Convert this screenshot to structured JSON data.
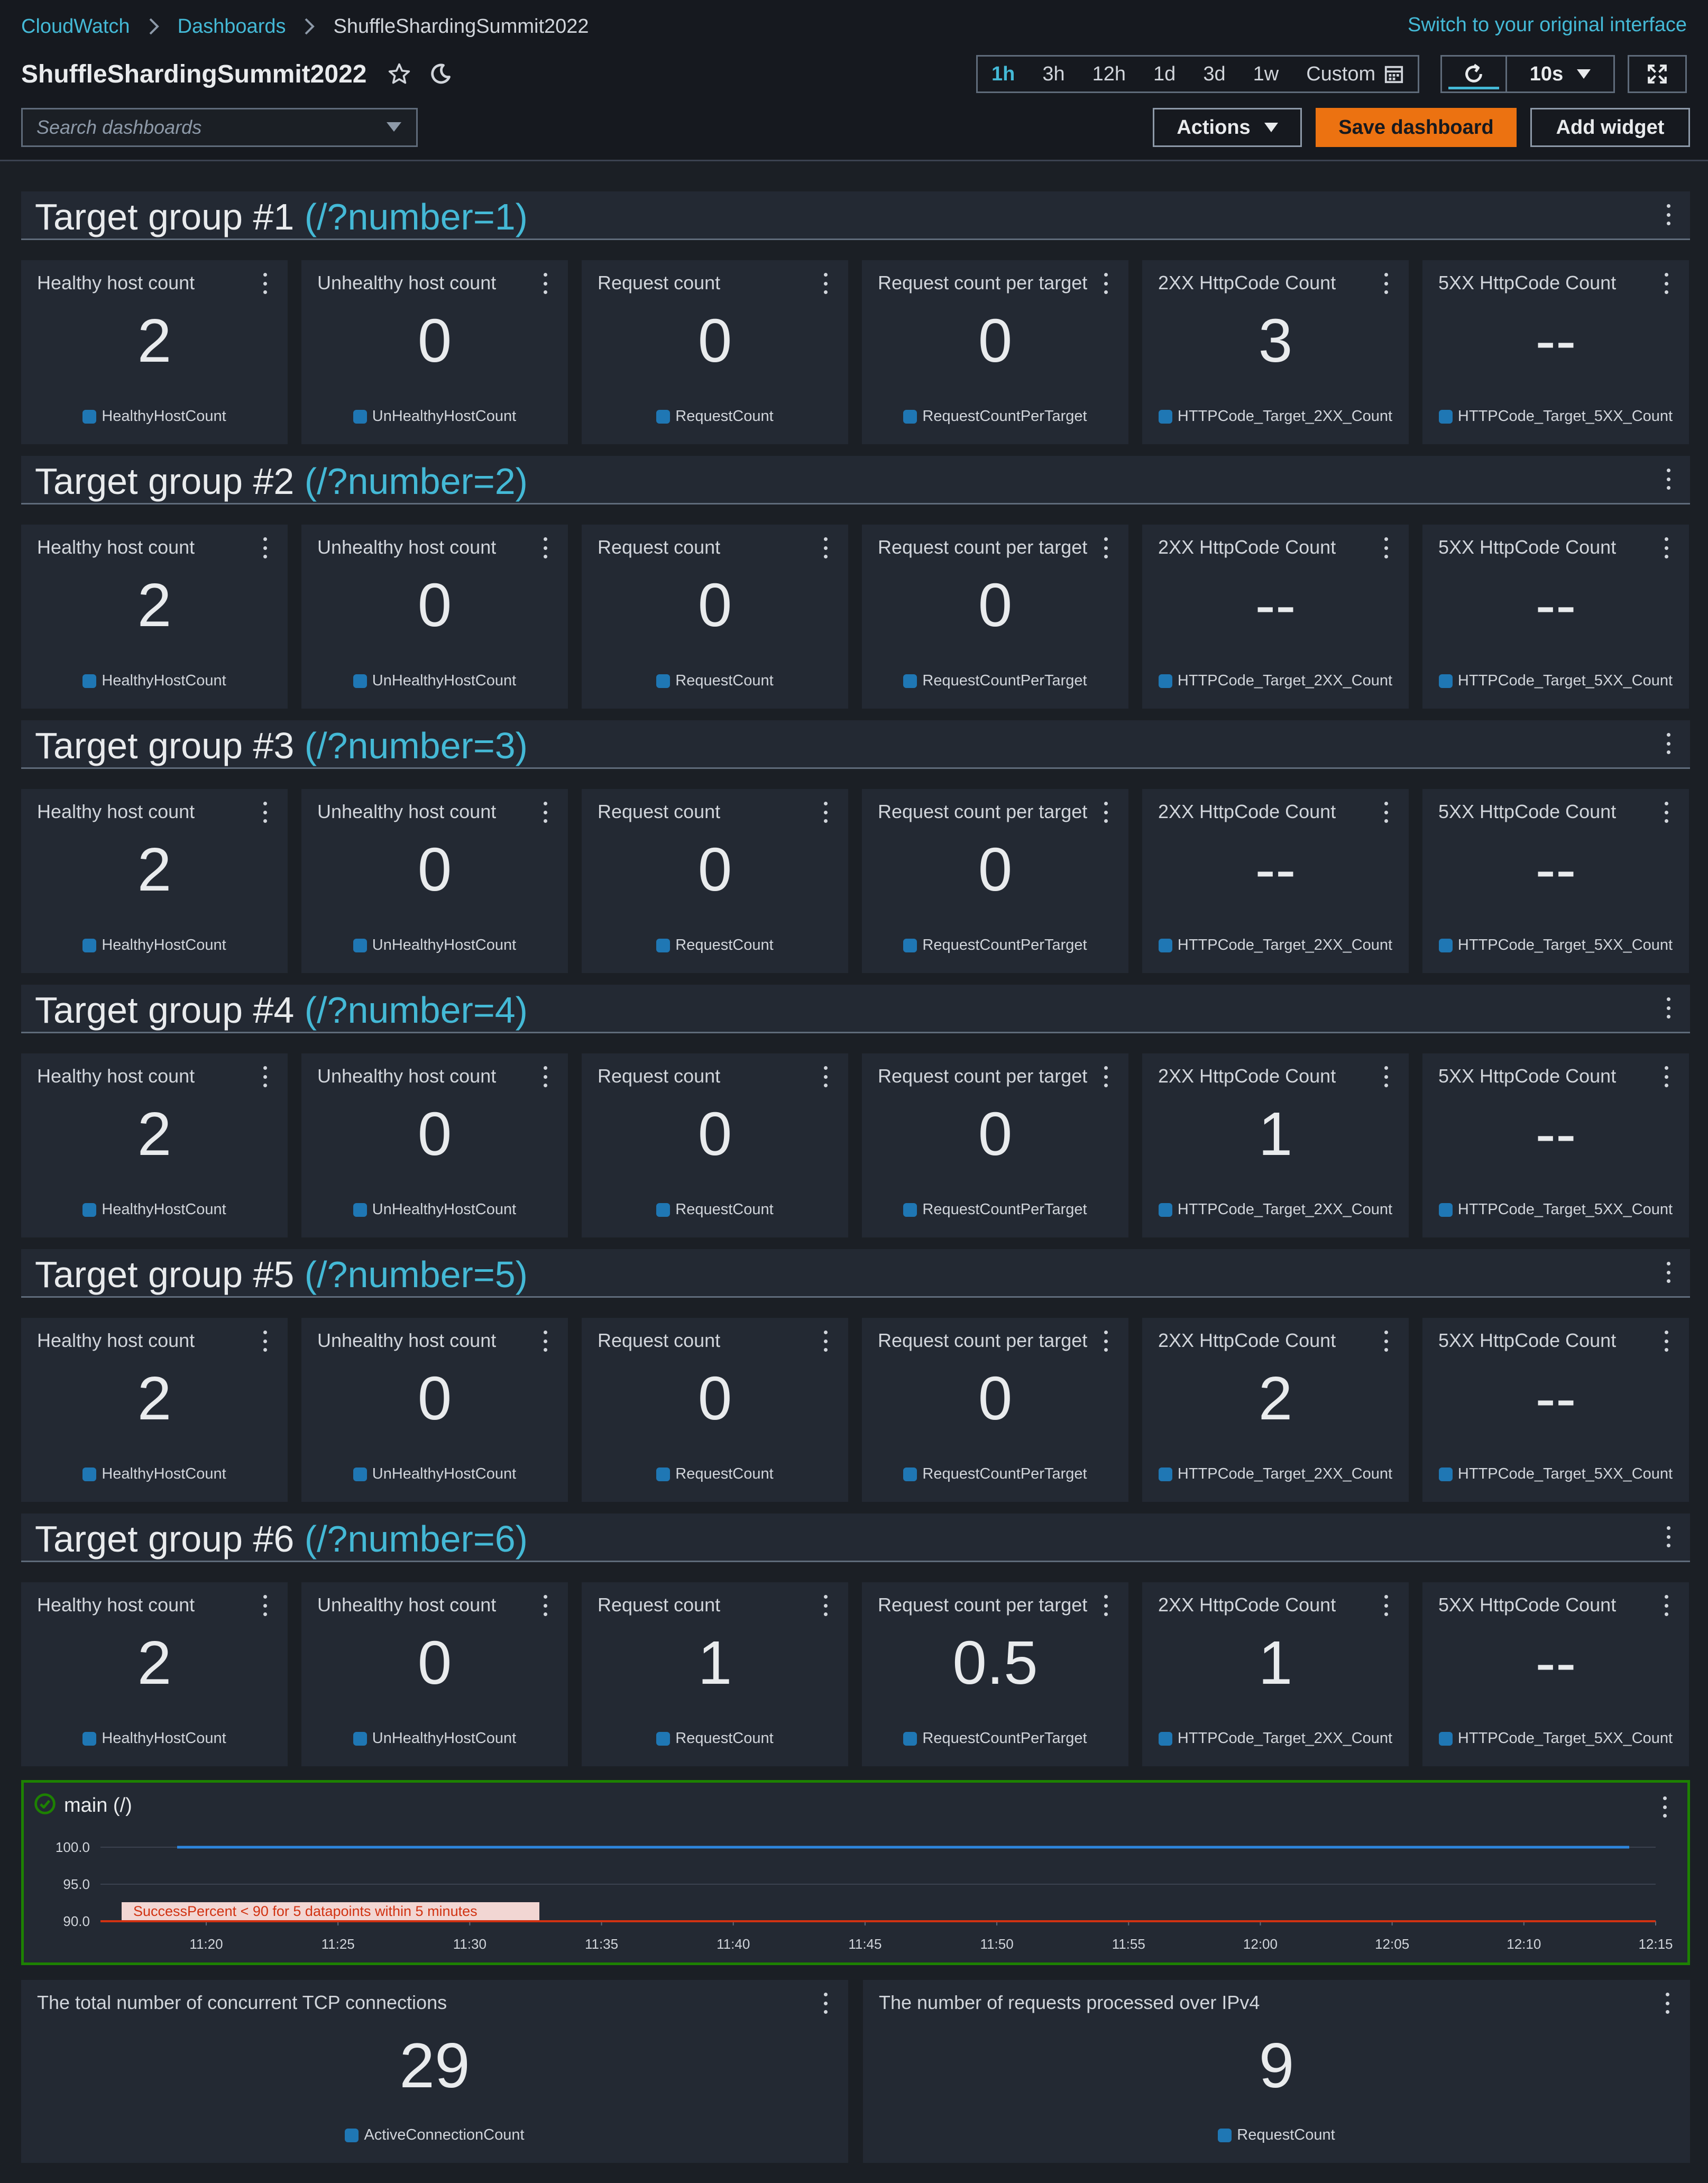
{
  "breadcrumb": [
    "CloudWatch",
    "Dashboards",
    "ShuffleShardingSummit2022"
  ],
  "switch_interface": "Switch to your original interface",
  "title": "ShuffleShardingSummit2022",
  "time_ranges": [
    "1h",
    "3h",
    "12h",
    "1d",
    "3d",
    "1w"
  ],
  "active_time_range": "1h",
  "custom_label": "Custom",
  "refresh_interval": "10s",
  "search_placeholder": "Search dashboards",
  "actions_label": "Actions",
  "save_label": "Save dashboard",
  "add_widget_label": "Add widget",
  "series_color": "#1f77b4",
  "widget_titles": [
    "Healthy host count",
    "Unhealthy host count",
    "Request count",
    "Request count per target",
    "2XX HttpCode Count",
    "5XX HttpCode Count"
  ],
  "metric_names": [
    "HealthyHostCount",
    "UnHealthyHostCount",
    "RequestCount",
    "RequestCountPerTarget",
    "HTTPCode_Target_2XX_Count",
    "HTTPCode_Target_5XX_Count"
  ],
  "groups": [
    {
      "title": "Target group #1",
      "path": "(/?number=1)",
      "values": [
        "2",
        "0",
        "0",
        "0",
        "3",
        "--"
      ]
    },
    {
      "title": "Target group #2",
      "path": "(/?number=2)",
      "values": [
        "2",
        "0",
        "0",
        "0",
        "--",
        "--"
      ]
    },
    {
      "title": "Target group #3",
      "path": "(/?number=3)",
      "values": [
        "2",
        "0",
        "0",
        "0",
        "--",
        "--"
      ]
    },
    {
      "title": "Target group #4",
      "path": "(/?number=4)",
      "values": [
        "2",
        "0",
        "0",
        "0",
        "1",
        "--"
      ]
    },
    {
      "title": "Target group #5",
      "path": "(/?number=5)",
      "values": [
        "2",
        "0",
        "0",
        "0",
        "2",
        "--"
      ]
    },
    {
      "title": "Target group #6",
      "path": "(/?number=6)",
      "values": [
        "2",
        "0",
        "1",
        "0.5",
        "1",
        "--"
      ]
    }
  ],
  "main_widget": {
    "title": "main (/)",
    "status": "OK"
  },
  "chart_data": {
    "type": "line",
    "x": [
      "11:20",
      "11:25",
      "11:30",
      "11:35",
      "11:40",
      "11:45",
      "11:50",
      "11:55",
      "12:00",
      "12:05",
      "12:10",
      "12:15"
    ],
    "yticks": [
      "100.0",
      "95.0",
      "90.0"
    ],
    "ylim": [
      90,
      100
    ],
    "series": [
      {
        "values": [
          100,
          100,
          100,
          100,
          100,
          100,
          100,
          100,
          100,
          100,
          100,
          100
        ],
        "color": "#2e86de"
      }
    ],
    "threshold": {
      "value": 90,
      "label": "SuccessPercent < 90 for 5 datapoints within 5 minutes",
      "color": "#d13212"
    },
    "grid": true
  },
  "bottom_widgets": [
    {
      "title": "The total number of concurrent TCP connections",
      "value": "29",
      "metric": "ActiveConnectionCount"
    },
    {
      "title": "The number of requests processed over IPv4",
      "value": "9",
      "metric": "RequestCount"
    }
  ]
}
